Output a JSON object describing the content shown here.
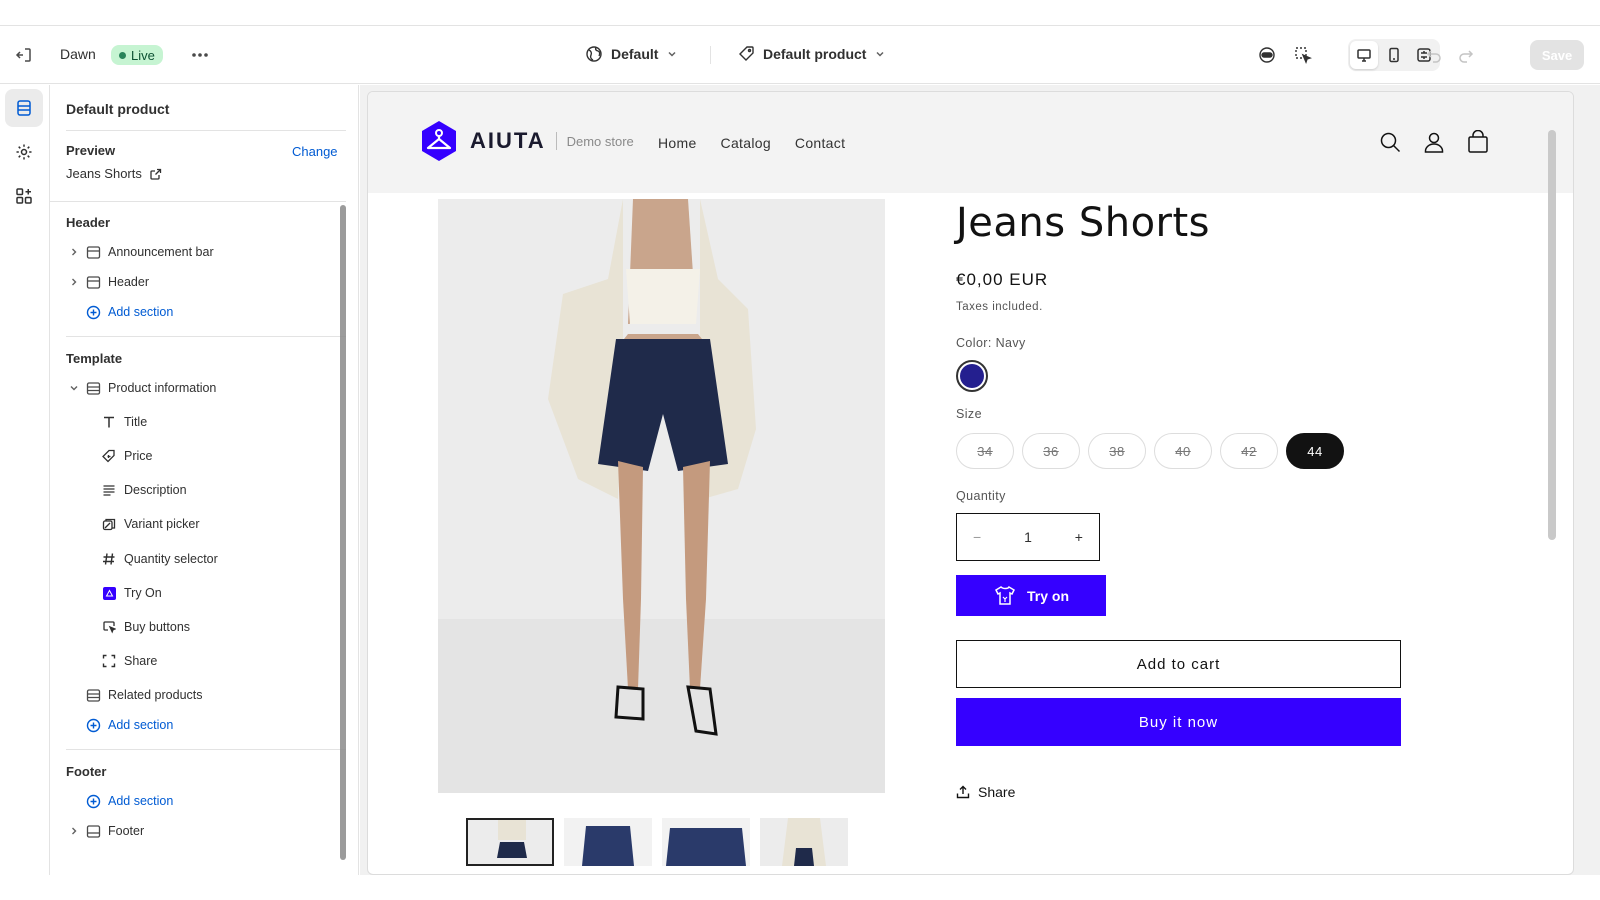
{
  "topbar": {
    "theme_name": "Dawn",
    "status_badge": "Live",
    "view_dropdown": "Default",
    "template_dropdown": "Default product",
    "save_label": "Save"
  },
  "sidebar": {
    "title": "Default product",
    "preview_label": "Preview",
    "change_label": "Change",
    "preview_value": "Jeans Shorts",
    "header_group": {
      "title": "Header",
      "items": [
        "Announcement bar",
        "Header"
      ],
      "add_section": "Add section"
    },
    "template_group": {
      "title": "Template",
      "section": "Product information",
      "blocks": [
        "Title",
        "Price",
        "Description",
        "Variant picker",
        "Quantity selector",
        "Try On",
        "Buy buttons",
        "Share"
      ],
      "related": "Related products",
      "add_section": "Add section"
    },
    "footer_group": {
      "title": "Footer",
      "add_section": "Add section",
      "item": "Footer"
    }
  },
  "store": {
    "brand": "AIUTA",
    "tagline": "Demo store",
    "nav": [
      "Home",
      "Catalog",
      "Contact"
    ],
    "product": {
      "title": "Jeans Shorts",
      "price": "€0,00 EUR",
      "tax_note": "Taxes included.",
      "color_label": "Color: Navy",
      "color_value": "#241f8f",
      "size_label": "Size",
      "sizes": [
        "34",
        "36",
        "38",
        "40",
        "42",
        "44"
      ],
      "selected_size": "44",
      "quantity_label": "Quantity",
      "quantity": "1",
      "minus": "−",
      "plus": "+",
      "try_on_label": "Try on",
      "add_to_cart_label": "Add to cart",
      "buy_now_label": "Buy it now",
      "share_label": "Share"
    }
  },
  "colors": {
    "accent": "#3500ff",
    "link": "#005bd3",
    "live_bg": "#c6f4d2"
  }
}
